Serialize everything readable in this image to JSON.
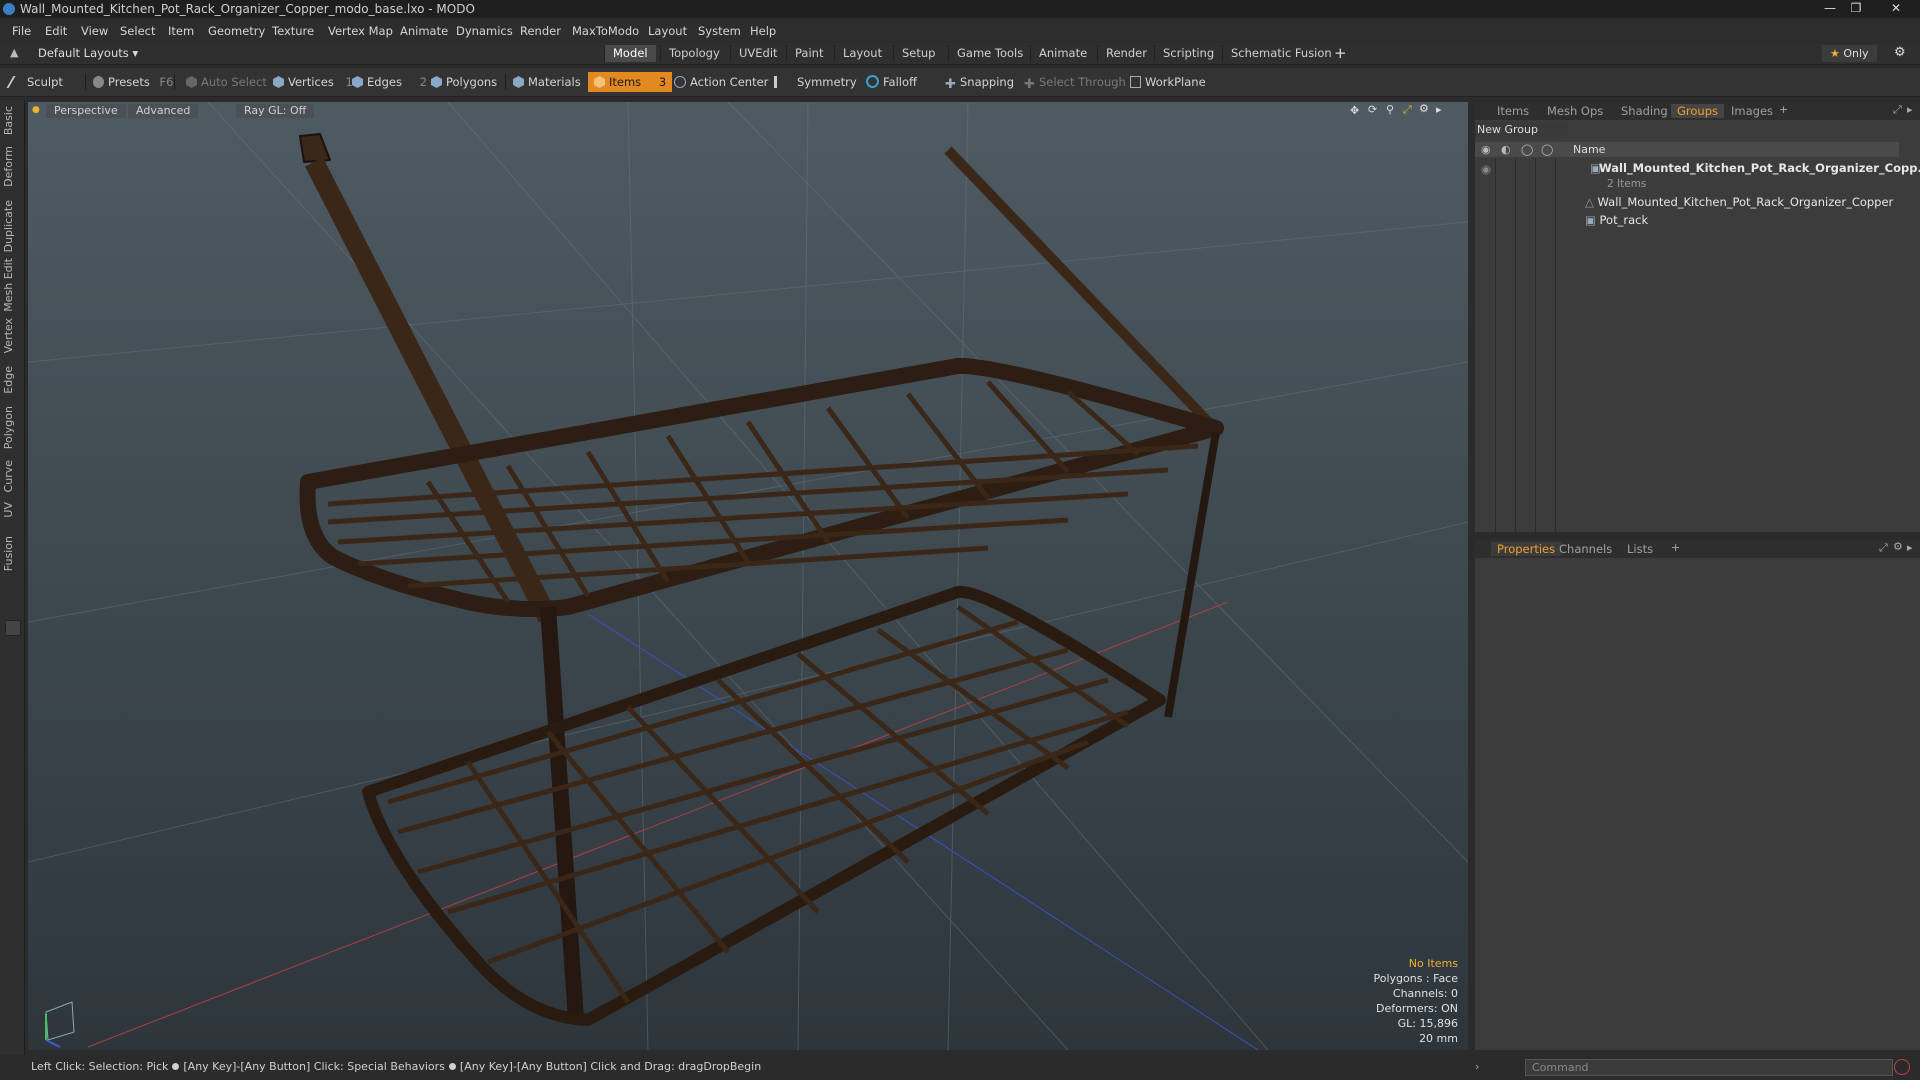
{
  "window": {
    "title": "Wall_Mounted_Kitchen_Pot_Rack_Organizer_Copper_modo_base.lxo - MODO"
  },
  "menu": [
    "File",
    "Edit",
    "View",
    "Select",
    "Item",
    "Geometry",
    "Texture",
    "Vertex Map",
    "Animate",
    "Dynamics",
    "Render",
    "MaxToModo",
    "Layout",
    "System",
    "Help"
  ],
  "layouts": {
    "label": "Default Layouts"
  },
  "layout_tabs": [
    "Model",
    "Topology",
    "UVEdit",
    "Paint",
    "Layout",
    "Setup",
    "Game Tools",
    "Animate",
    "Render",
    "Scripting",
    "Schematic Fusion"
  ],
  "only_label": "Only",
  "toolbar": {
    "sculpt": "Sculpt",
    "presets": "Presets",
    "presets_key": "F6",
    "auto_select": "Auto Select",
    "vertices": "Vertices",
    "vertices_count": "1",
    "edges": "Edges",
    "edges_count": "2",
    "polygons": "Polygons",
    "materials": "Materials",
    "items": "Items",
    "items_count": "3",
    "action_center": "Action Center",
    "symmetry": "Symmetry",
    "falloff": "Falloff",
    "snapping": "Snapping",
    "select_through": "Select Through",
    "workplane": "WorkPlane"
  },
  "left_palette": [
    "Basic",
    "Deform",
    "Duplicate",
    "Mesh Edit",
    "Vertex",
    "Edge",
    "Polygon",
    "Curve",
    "UV",
    "Fusion"
  ],
  "viewport": {
    "view": "Perspective",
    "shading": "Advanced",
    "raygl": "Ray GL: Off",
    "stats": {
      "items": "No Items",
      "polygons": "Polygons : Face",
      "channels": "Channels: 0",
      "deformers": "Deformers: ON",
      "gl": "GL: 15,896",
      "size": "20 mm"
    }
  },
  "right_top": {
    "tabs": [
      "Items",
      "Mesh Ops",
      "Shading",
      "Groups",
      "Images"
    ],
    "active_tab": "Groups",
    "new_group": "New Group",
    "col_name": "Name",
    "group_name": "Wall_Mounted_Kitchen_Pot_Rack_Organizer_Copp...",
    "group_count": "2 Items",
    "children": [
      "Wall_Mounted_Kitchen_Pot_Rack_Organizer_Copper",
      "Pot_rack"
    ]
  },
  "right_bottom": {
    "tabs": [
      "Properties",
      "Channels",
      "Lists"
    ],
    "active_tab": "Properties"
  },
  "status": {
    "text1": "Left Click: Selection: Pick",
    "text2": "[Any Key]-[Any Button] Click: Special Behaviors",
    "text3": "[Any Key]-[Any Button] Click and Drag: dragDropBegin"
  },
  "command": {
    "placeholder": "Command"
  },
  "colors": {
    "accent": "#e28a21",
    "active_tab": "#f0a030"
  }
}
